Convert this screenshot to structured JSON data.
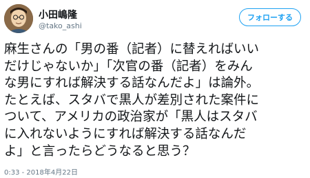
{
  "tweet": {
    "display_name": "小田嶋隆",
    "handle": "@tako_ashi",
    "follow_label": "フォローする",
    "avatar_icon": "user-avatar-icon",
    "lines": [
      "麻生さんの「男の番（記者）に替えればいい",
      "だけじゃないか」「次官の番（記者）をみん",
      "な男にすれば解決する話なんだよ」は論外。",
      "たとえば、スタバで黒人が差別された案件に",
      "ついて、アメリカの政治家が「黒人はスタバ",
      "に入れないようにすれば解決する話なんだ",
      "よ」と言ったらどうなると思う？"
    ],
    "timestamp": "0:33 - 2018年4月22日",
    "colors": {
      "accent": "#1da1f2",
      "text": "#14171a",
      "muted": "#657786"
    }
  }
}
